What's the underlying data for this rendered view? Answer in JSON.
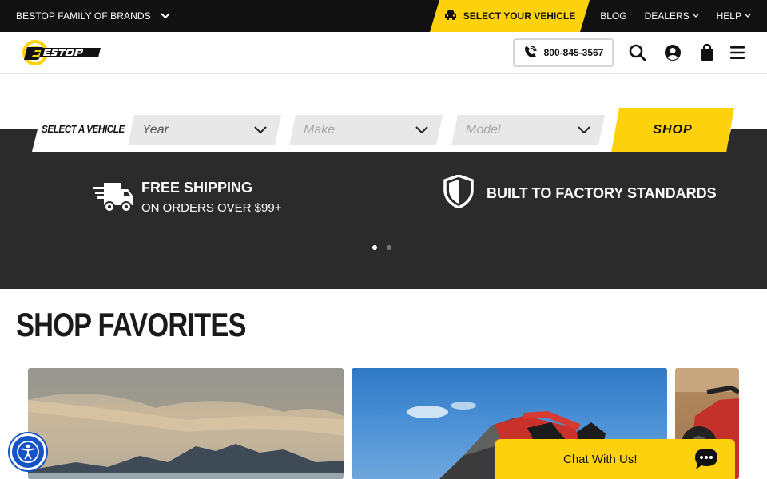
{
  "topbar": {
    "brands_label": "BESTOP FAMILY OF BRANDS",
    "select_vehicle": "SELECT YOUR VEHICLE",
    "links": {
      "blog": "BLOG",
      "dealers": "DEALERS",
      "help": "HELP"
    }
  },
  "header": {
    "phone": "800-845-3567",
    "logo_text": "Bestop"
  },
  "selector": {
    "label": "SELECT A VEHICLE",
    "year": "Year",
    "make": "Make",
    "model": "Model",
    "shop": "SHOP"
  },
  "features": {
    "shipping_title": "FREE SHIPPING",
    "shipping_sub": "ON ORDERS OVER $99+",
    "factory_title": "BUILT TO FACTORY STANDARDS"
  },
  "carousel": {
    "slides": 2,
    "active": 1
  },
  "section": {
    "title": "SHOP FAVORITES"
  },
  "chat": {
    "label": "Chat With Us!"
  },
  "colors": {
    "accent": "#fdd20d",
    "dark": "#2b2b2b",
    "topbar": "#111111",
    "accessibility": "#1554c5"
  }
}
